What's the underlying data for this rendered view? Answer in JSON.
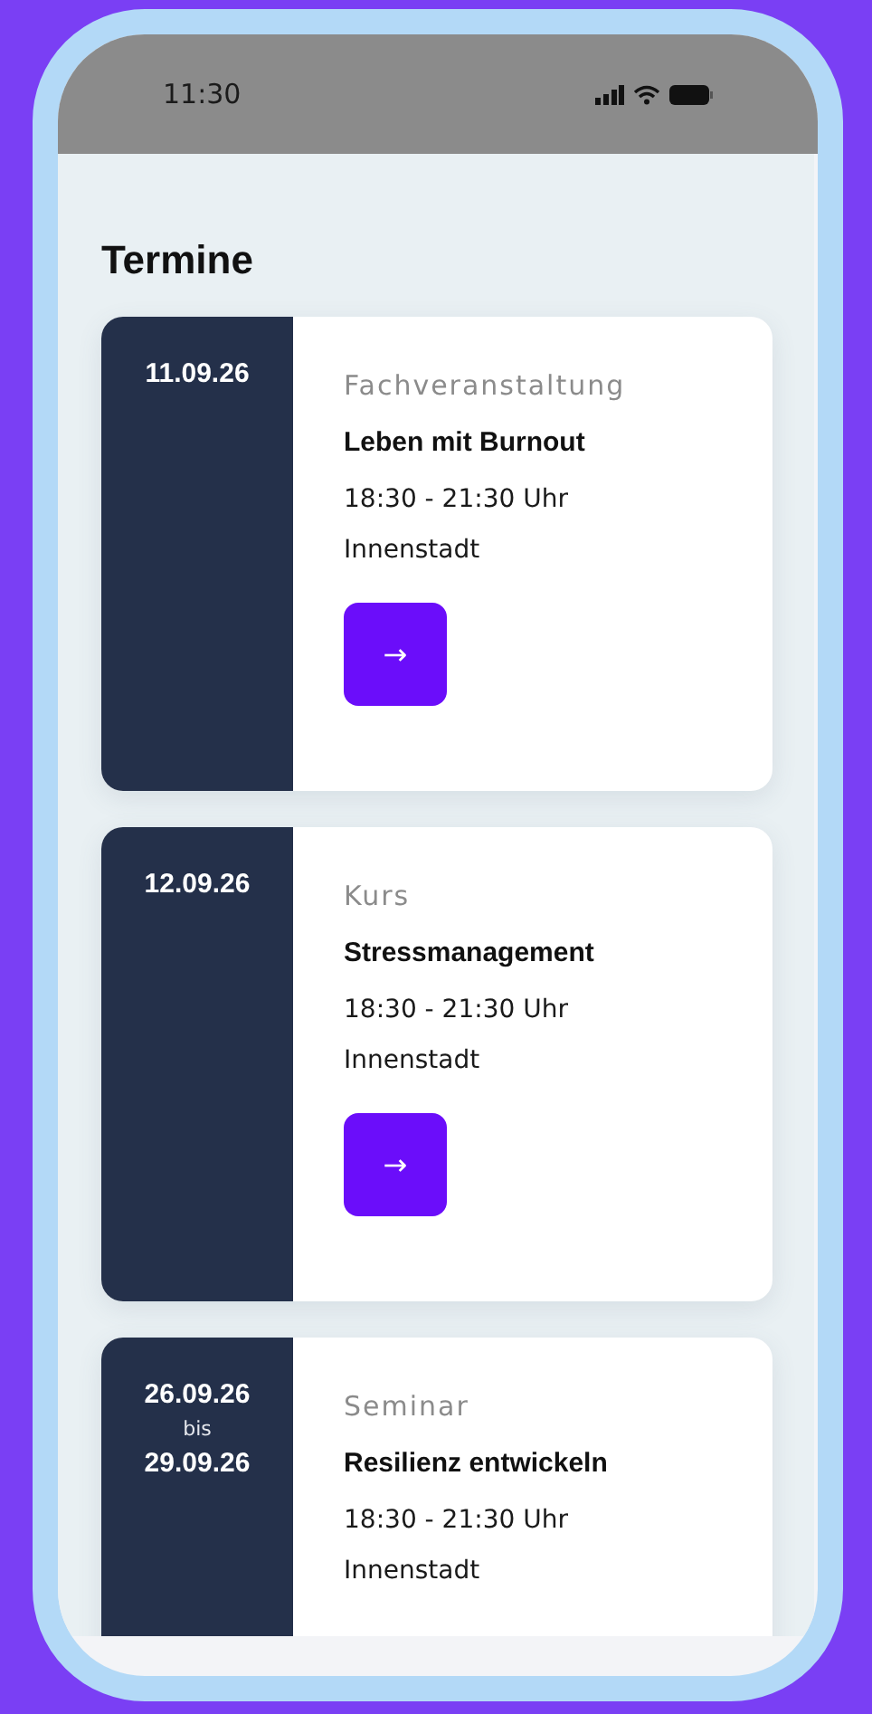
{
  "status_bar": {
    "time": "11:30"
  },
  "title": "Termine",
  "events": [
    {
      "dates": {
        "start": "11.09.26"
      },
      "category": "Fachveranstaltung",
      "name": "Leben mit Burnout",
      "time": "18:30 - 21:30 Uhr",
      "location": "Innenstadt",
      "button": "→"
    },
    {
      "dates": {
        "start": "12.09.26"
      },
      "category": "Kurs",
      "name": "Stressmanagement",
      "time": "18:30 - 21:30 Uhr",
      "location": "Innenstadt",
      "button": "→"
    },
    {
      "dates": {
        "start": "26.09.26",
        "separator": "bis",
        "end": "29.09.26"
      },
      "category": "Seminar",
      "name": "Resilienz entwickeln",
      "time": "18:30 - 21:30 Uhr",
      "location": "Innenstadt"
    }
  ]
}
